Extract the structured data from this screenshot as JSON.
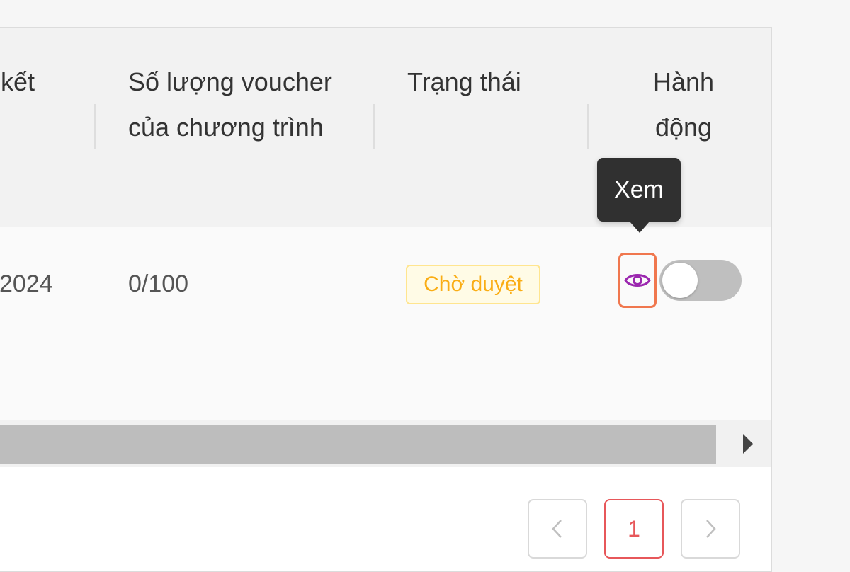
{
  "table": {
    "columns": {
      "end_partial": "kết",
      "quantity": "Số lượng voucher của chương trình",
      "status": "Trạng thái",
      "action": "Hành động"
    },
    "rows": [
      {
        "end_date_partial": "2024",
        "quantity": "0/100",
        "status": "Chờ duyệt",
        "toggle_on": false
      }
    ]
  },
  "tooltip": {
    "text": "Xem"
  },
  "pagination": {
    "current_page": "1"
  },
  "colors": {
    "badge_text": "#faad14",
    "badge_border": "#ffe58f",
    "eye_icon": "#9b27af",
    "highlight_border": "#f0774e",
    "active_page": "#e7575a"
  },
  "icons": {
    "view": "eye-icon",
    "prev": "chevron-left-icon",
    "next": "chevron-right-icon",
    "scroll": "caret-right-icon"
  }
}
